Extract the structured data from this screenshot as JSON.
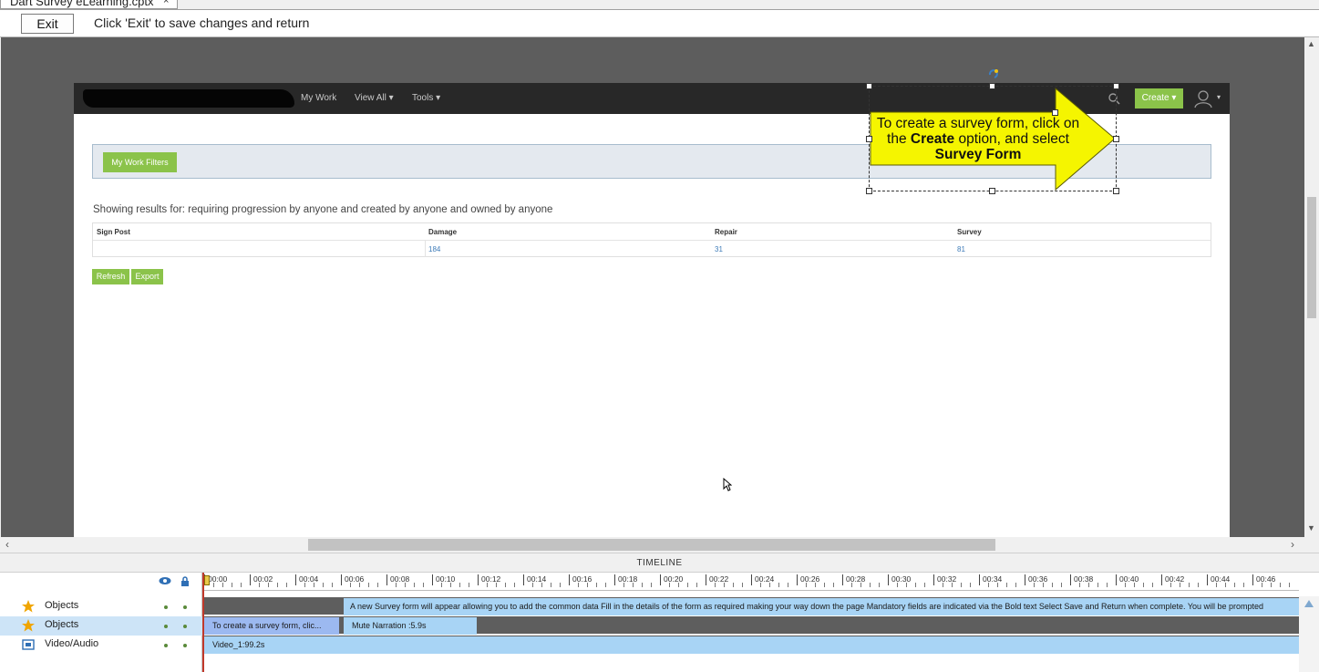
{
  "file_tab": {
    "label": "Dart Survey eLearning.cptx",
    "close": "×"
  },
  "exit_bar": {
    "exit_label": "Exit",
    "hint": "Click 'Exit' to save changes and return"
  },
  "slide": {
    "nav": {
      "my_work": "My Work",
      "view_all": "View All ▾",
      "tools": "Tools ▾",
      "create": "Create ▾",
      "user_caret": "▾"
    },
    "filters_button": "My Work Filters",
    "results_text": "Showing results for: requiring progression by anyone and created by anyone and owned by anyone",
    "table": {
      "headers": [
        "Sign Post",
        "Damage",
        "Repair",
        "Survey"
      ],
      "values": [
        "",
        "184",
        "31",
        "81"
      ]
    },
    "refresh_label": "Refresh",
    "export_label": "Export",
    "callout": {
      "line1": "To create a survey form, click on",
      "line2_pre": "the ",
      "line2_bold": "Create",
      "line2_post": " option, and select",
      "line3_bold": "Survey Form"
    }
  },
  "timeline": {
    "title": "TIMELINE",
    "ruler_ticks": [
      "00:00",
      "00:02",
      "00:04",
      "00:06",
      "00:08",
      "00:10",
      "00:12",
      "00:14",
      "00:16",
      "00:18",
      "00:20",
      "00:22",
      "00:24",
      "00:26",
      "00:28",
      "00:30",
      "00:32",
      "00:34",
      "00:36",
      "00:38",
      "00:40",
      "00:42",
      "00:44",
      "00:46"
    ],
    "layers": [
      {
        "name": "Objects",
        "icon": "star-icon"
      },
      {
        "name": "Objects",
        "icon": "star-icon"
      },
      {
        "name": "Video/Audio",
        "icon": "video-icon"
      }
    ],
    "track1_text": "A new Survey form will appear allowing you to add the common data  Fill in the details of the form as required making your way down the page  Mandatory fields are indicated via the Bold text  Select Save and Return when complete. You will be prompted",
    "track2_caption": "To create a survey form, clic...",
    "track2_narration": "Mute Narration :5.9s",
    "track3_video": "Video_1:99.2s"
  },
  "colors": {
    "accent_green": "#8bc34a",
    "callout_yellow": "#f5f500",
    "track_blue": "#a8d4f5",
    "caption_blue": "#9cb9f0"
  }
}
